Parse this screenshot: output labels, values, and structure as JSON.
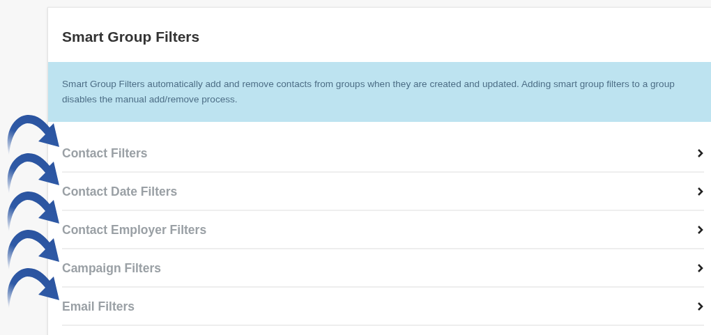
{
  "panel": {
    "title": "Smart Group Filters",
    "notice": "Smart Group Filters automatically add and remove contacts from groups when they are created and updated. Adding smart group filters to a group disables the manual add/remove process.",
    "filters": [
      {
        "label": "Contact Filters",
        "expanded": false
      },
      {
        "label": "Contact Date Filters",
        "expanded": false
      },
      {
        "label": "Contact Employer Filters",
        "expanded": false
      },
      {
        "label": "Campaign Filters",
        "expanded": false
      },
      {
        "label": "Email Filters",
        "expanded": false
      }
    ]
  }
}
